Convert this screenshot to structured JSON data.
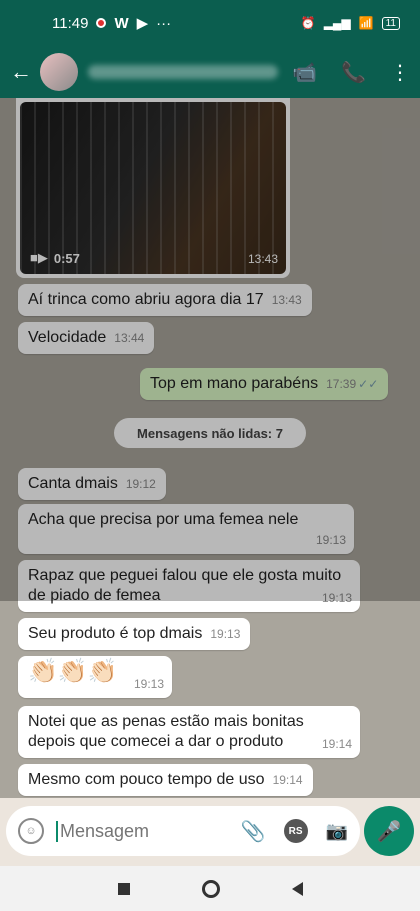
{
  "status_bar": {
    "time": "11:49",
    "battery": "11"
  },
  "video": {
    "duration": "0:57",
    "time": "13:43"
  },
  "messages": [
    {
      "text": "Aí trinca como abriu agora dia 17",
      "time": "13:43"
    },
    {
      "text": "Velocidade",
      "time": "13:44"
    },
    {
      "text": "Top em mano parabéns",
      "time": "17:39",
      "ticks": "✓✓"
    },
    {
      "text": "Canta dmais",
      "time": "19:12"
    },
    {
      "text": "Acha que precisa por uma femea nele",
      "time": "19:13"
    },
    {
      "text": "Rapaz que peguei falou que ele gosta muito de piado de femea",
      "time": "19:13"
    },
    {
      "text": "Seu produto é  top dmais",
      "time": "19:13"
    },
    {
      "text": "👏🏻👏🏻👏🏻",
      "time": "19:13"
    },
    {
      "text": "Notei que as penas estão mais bonitas depois que comecei a dar o produto",
      "time": "19:14"
    },
    {
      "text": "Mesmo com pouco tempo de uso",
      "time": "19:14"
    }
  ],
  "unread_label": "Mensagens não lidas: 7",
  "input": {
    "placeholder": "Mensagem"
  },
  "icons": {
    "rs_badge": "RS"
  },
  "colors": {
    "header": "#0b5e4f",
    "accent": "#0b8a6a",
    "outgoing": "#dcf8c6"
  }
}
